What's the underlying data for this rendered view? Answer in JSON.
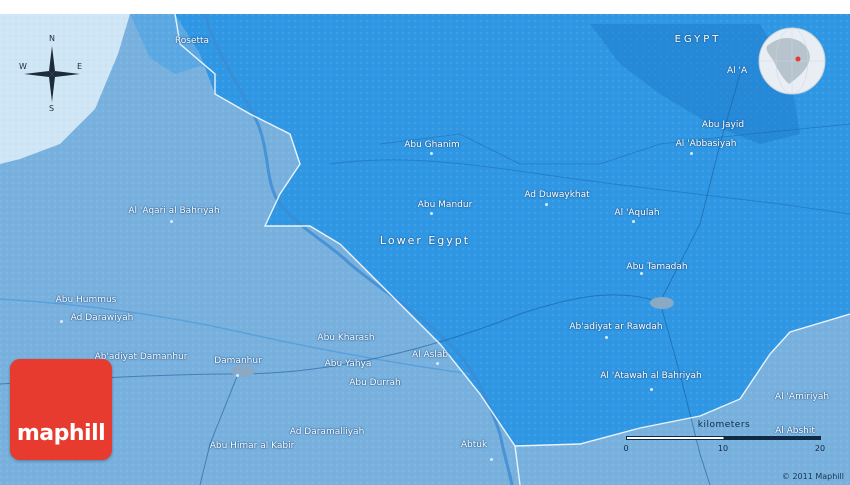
{
  "country": "EGYPT",
  "region": "Lower Egypt",
  "brand": {
    "name": "maphill",
    "color": "#e63b2e"
  },
  "copyright": "© 2011 Maphill",
  "compass": {
    "north": "N",
    "south": "S",
    "east": "E",
    "west": "W"
  },
  "scale": {
    "title": "kilometers",
    "ticks": [
      "0",
      "10",
      "20"
    ]
  },
  "colors": {
    "region_fill": "#2f97e3",
    "outside_fill": "#78b0de",
    "sea": "#cfe6f6",
    "border": "#e8f2fb",
    "river": "#3d8fd6"
  },
  "places": [
    {
      "name": "Rosetta"
    },
    {
      "name": "Abu Ghanim"
    },
    {
      "name": "Abu Mandur"
    },
    {
      "name": "Ad Duwaykhat"
    },
    {
      "name": "Al 'Aqulah"
    },
    {
      "name": "Abu Jayid"
    },
    {
      "name": "Al 'Abbasiyah"
    },
    {
      "name": "Al 'A"
    },
    {
      "name": "Al 'Aqari al Bahriyah"
    },
    {
      "name": "Abu Tamadah"
    },
    {
      "name": "Abu Hummus"
    },
    {
      "name": "Ad Darawiyah"
    },
    {
      "name": "Ab'adiyat ar Rawdah"
    },
    {
      "name": "Abu Kharash"
    },
    {
      "name": "Ab'adiyat Damanhur"
    },
    {
      "name": "Damanhur"
    },
    {
      "name": "Abu Yahya"
    },
    {
      "name": "Al Aslab"
    },
    {
      "name": "Abu Durrah"
    },
    {
      "name": "Al 'Atawah al Bahriyah"
    },
    {
      "name": "Al 'Amiriyah"
    },
    {
      "name": "Ad Daramalliyah"
    },
    {
      "name": "Al Abshit"
    },
    {
      "name": "Abu Himar al Kabir"
    },
    {
      "name": "Abtuk"
    }
  ]
}
